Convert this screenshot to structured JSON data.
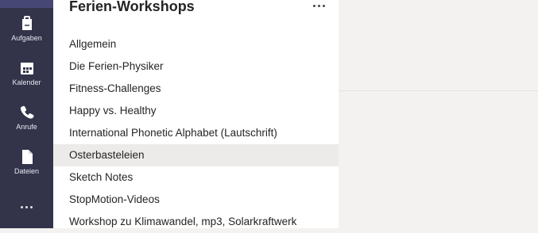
{
  "rail": {
    "items": [
      {
        "label": "Aufgaben",
        "icon": "tasks-icon"
      },
      {
        "label": "Kalender",
        "icon": "calendar-icon"
      },
      {
        "label": "Anrufe",
        "icon": "phone-icon"
      },
      {
        "label": "Dateien",
        "icon": "file-icon"
      }
    ],
    "more_icon": "more-horizontal-icon",
    "background": "#33344a"
  },
  "team": {
    "name": "Ferien-Workshops",
    "menu_icon": "more-options-icon",
    "channels": [
      {
        "label": "Allgemein"
      },
      {
        "label": "Die Ferien-Physiker"
      },
      {
        "label": "Fitness-Challenges"
      },
      {
        "label": "Happy vs. Healthy"
      },
      {
        "label": "International Phonetic Alphabet (Lautschrift)"
      },
      {
        "label": "Osterbasteleien",
        "selected": true
      },
      {
        "label": "Sketch Notes"
      },
      {
        "label": "StopMotion-Videos"
      },
      {
        "label": "Workshop zu Klimawandel, mp3, Solarkraftwerk"
      }
    ]
  },
  "colors": {
    "selected_channel_bg": "#edebe9",
    "content_bg": "#f3f2f1"
  }
}
